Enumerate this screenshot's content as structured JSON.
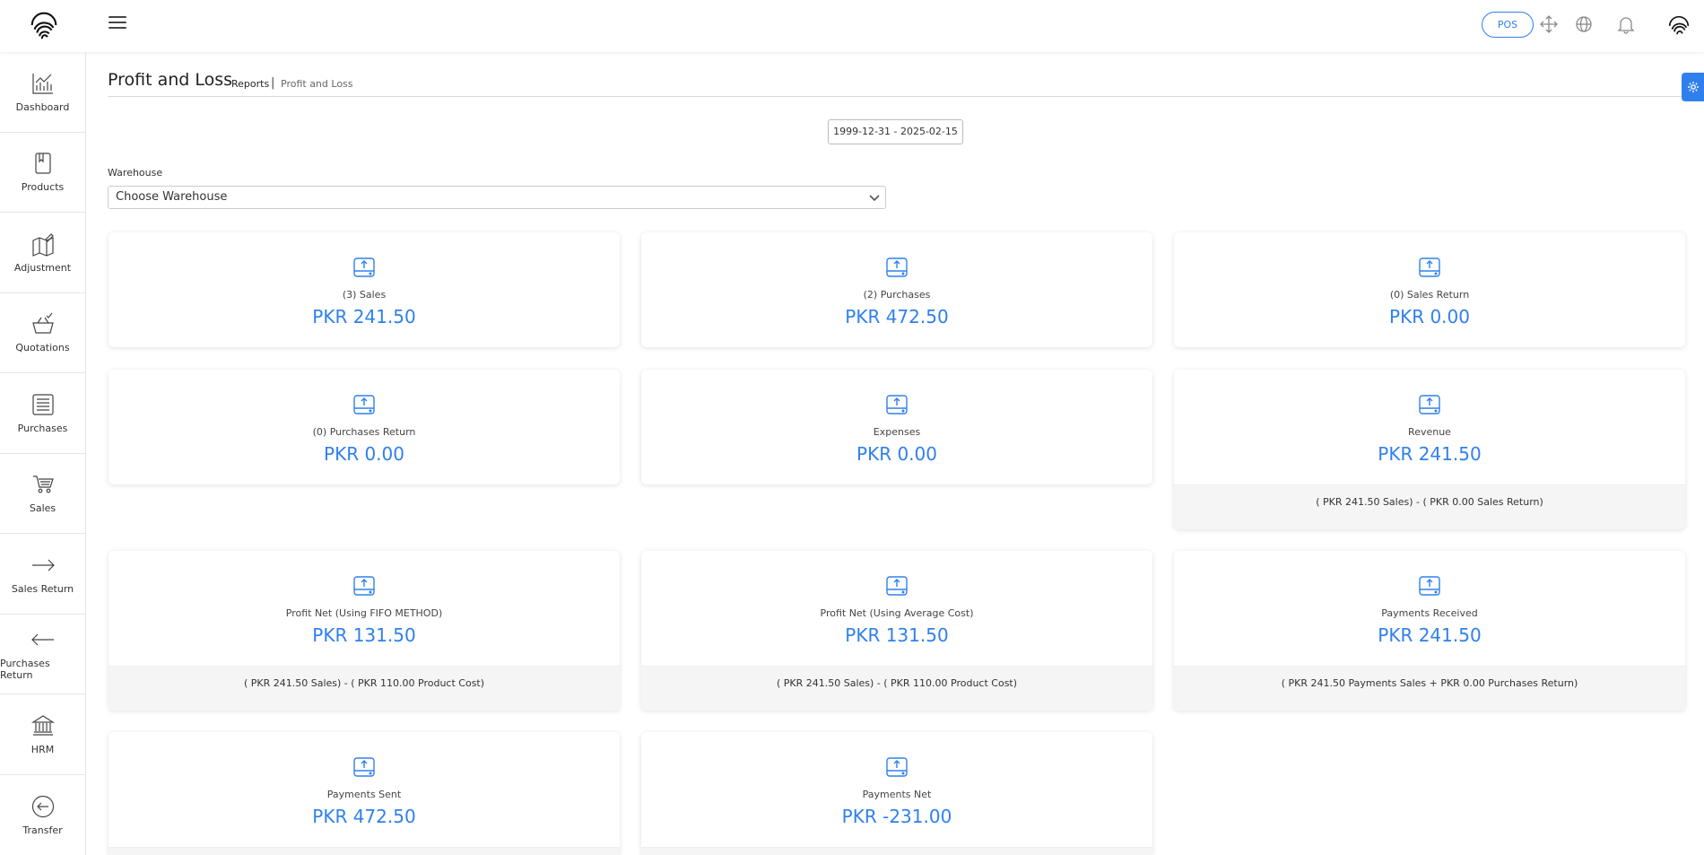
{
  "topbar": {
    "pos_label": "POS",
    "icons": [
      "fullscreen-icon",
      "globe-icon",
      "bell-icon"
    ]
  },
  "sidebar": {
    "items": [
      {
        "label": "Dashboard",
        "icon": "chart-icon"
      },
      {
        "label": "Products",
        "icon": "book-icon"
      },
      {
        "label": "Adjustment",
        "icon": "map-edit-icon"
      },
      {
        "label": "Quotations",
        "icon": "basket-check-icon"
      },
      {
        "label": "Purchases",
        "icon": "receipt-icon"
      },
      {
        "label": "Sales",
        "icon": "cart-icon"
      },
      {
        "label": "Sales Return",
        "icon": "arrow-right-icon"
      },
      {
        "label": "Purchases Return",
        "icon": "arrow-left-icon"
      },
      {
        "label": "HRM",
        "icon": "bank-icon"
      },
      {
        "label": "Transfer",
        "icon": "transfer-icon"
      }
    ]
  },
  "page": {
    "title": "Profit and Loss",
    "breadcrumb_parent": "Reports",
    "breadcrumb_separator": "|",
    "breadcrumb_current": "Profit and Loss",
    "date_range": "1999-12-31 - 2025-02-15",
    "warehouse_label": "Warehouse",
    "warehouse_value": "Choose Warehouse"
  },
  "cards": [
    {
      "name": "(3) Sales",
      "value": "PKR 241.50",
      "footer": ""
    },
    {
      "name": "(2) Purchases",
      "value": "PKR 472.50",
      "footer": ""
    },
    {
      "name": "(0) Sales Return",
      "value": "PKR 0.00",
      "footer": ""
    },
    {
      "name": "(0) Purchases Return",
      "value": "PKR 0.00",
      "footer": ""
    },
    {
      "name": "Expenses",
      "value": "PKR 0.00",
      "footer": ""
    },
    {
      "name": "Revenue",
      "value": "PKR 241.50",
      "footer": "( PKR 241.50 Sales) - ( PKR 0.00 Sales Return)"
    },
    {
      "name": "Profit Net (Using FIFO METHOD)",
      "value": "PKR 131.50",
      "footer": "( PKR 241.50 Sales) - ( PKR 110.00 Product Cost)"
    },
    {
      "name": "Profit Net (Using Average Cost)",
      "value": "PKR 131.50",
      "footer": "( PKR 241.50 Sales) - ( PKR 110.00 Product Cost)"
    },
    {
      "name": "Payments Received",
      "value": "PKR 241.50",
      "footer": "( PKR 241.50 Payments Sales + PKR 0.00 Purchases Return)"
    },
    {
      "name": "Payments Sent",
      "value": "PKR 472.50",
      "footer": ""
    },
    {
      "name": "Payments Net",
      "value": "PKR -231.00",
      "footer": ""
    }
  ],
  "colors": {
    "accent": "#2f80ed",
    "footer_bg": "#f5f5f5"
  }
}
